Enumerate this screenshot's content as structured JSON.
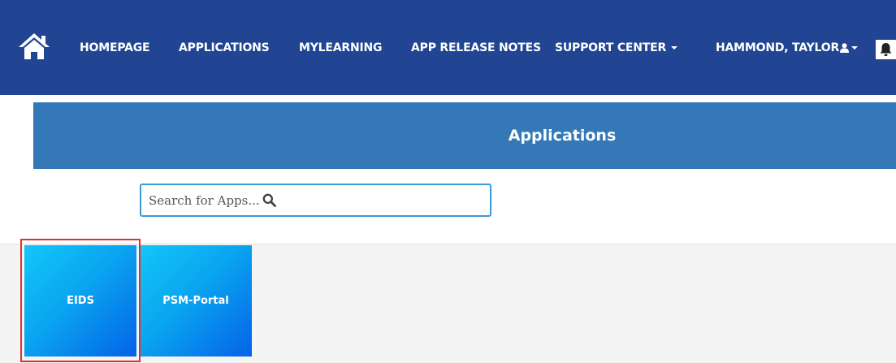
{
  "nav": {
    "home_icon": "home-icon",
    "items": [
      {
        "label": "HOMEPAGE"
      },
      {
        "label": "APPLICATIONS"
      },
      {
        "label": "MYLEARNING"
      },
      {
        "label": "APP RELEASE NOTES"
      },
      {
        "label": "SUPPORT CENTER"
      }
    ],
    "user_label": "HAMMOND, TAYLOR",
    "user_icon": "user-icon",
    "notification_icon": "bell-icon"
  },
  "header": {
    "title": "Applications"
  },
  "search": {
    "placeholder": "Search for Apps...",
    "value": "",
    "icon": "search-icon"
  },
  "apps": [
    {
      "label": "EIDS",
      "highlighted": true
    },
    {
      "label": "PSM-Portal",
      "highlighted": false
    }
  ],
  "colors": {
    "navbar_bg": "#214593",
    "header_bg": "#3578b8",
    "tile_gradient_start": "#12c7f7",
    "tile_gradient_end": "#0462e8",
    "search_border": "#3a9ad9",
    "highlight_border": "#e03131",
    "tiles_area_bg": "#f4f4f4"
  }
}
